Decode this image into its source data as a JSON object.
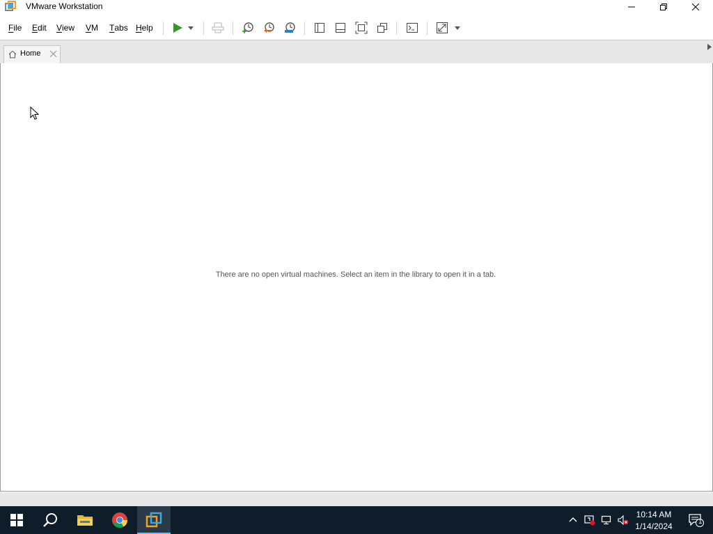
{
  "window": {
    "title": "VMware Workstation"
  },
  "menu": {
    "items": [
      {
        "hot": "F",
        "rest": "ile"
      },
      {
        "hot": "E",
        "rest": "dit"
      },
      {
        "hot": "V",
        "rest": "iew"
      },
      {
        "hot": "V",
        "rest": "M"
      },
      {
        "hot": "T",
        "rest": "abs"
      },
      {
        "hot": "H",
        "rest": "elp"
      }
    ]
  },
  "toolbar": {
    "icons": [
      "power-on-icon",
      "dropdown-arrow-icon",
      "send-ctrl-alt-del-icon",
      "take-snapshot-icon",
      "revert-snapshot-icon",
      "snapshot-manager-icon",
      "show-library-icon",
      "show-thumbnail-bar-icon",
      "full-screen-icon",
      "unity-icon",
      "console-view-icon",
      "stretch-guest-icon",
      "dropdown-arrow-icon"
    ],
    "colors": {
      "power_on": "#2f9c1f",
      "snapshot_revert": "#e06a1b",
      "snapshot_manager": "#1e88c7"
    }
  },
  "tabs": [
    {
      "label": "Home"
    }
  ],
  "content": {
    "empty_message": "There are no open virtual machines. Select an item in the library to open it in a tab."
  },
  "taskbar": {
    "apps": [
      "windows-start-icon",
      "search-icon",
      "file-explorer-icon",
      "chrome-icon",
      "vmware-workstation-icon"
    ],
    "tray": [
      "show-hidden-icons-chevron-icon",
      "security-alert-icon",
      "network-disconnected-icon",
      "volume-muted-icon"
    ],
    "time": "10:14 AM",
    "date": "1/14/2024",
    "notification_count": "1"
  }
}
